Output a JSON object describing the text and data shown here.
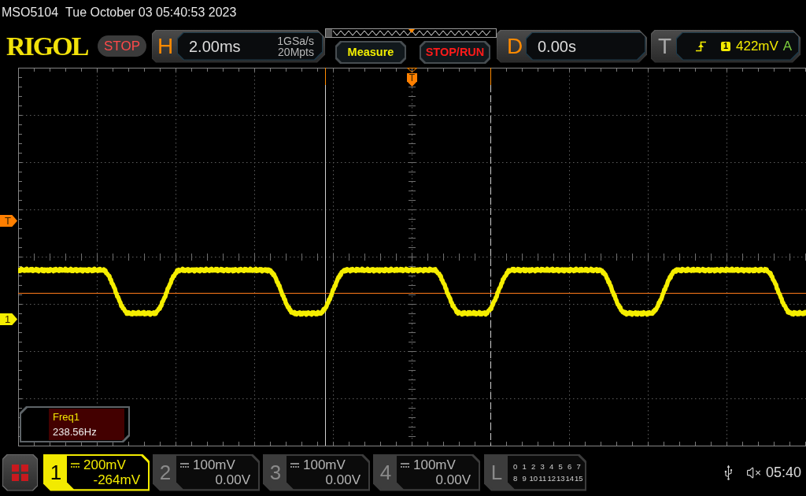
{
  "top_bar": {
    "model": "MSO5104",
    "datetime": "Tue October 03 05:40:53 2023"
  },
  "header": {
    "logo": "RIGOL",
    "run_state": "STOP",
    "horizontal": {
      "label": "H",
      "timebase": "2.00ms",
      "sample_rate": "1GSa/s",
      "memory_depth": "20Mpts"
    },
    "buttons": [
      {
        "label": "Measure",
        "kind": "measure"
      },
      {
        "label": "STOP/RUN",
        "kind": "run_stop"
      }
    ],
    "delay": {
      "label": "D",
      "value": "0.00s"
    },
    "trigger": {
      "label": "T",
      "source": "1",
      "level": "422mV",
      "mode": "A"
    }
  },
  "screen": {
    "trigger_position_marker": "T",
    "left_markers": [
      {
        "label": "T",
        "kind": "trigger"
      },
      {
        "label": "1",
        "kind": "channel"
      }
    ],
    "measurement": {
      "name": "Freq1",
      "value": "238.56Hz"
    }
  },
  "channels": [
    {
      "number": "1",
      "scale": "200mV",
      "offset": "-264mV",
      "on": true
    },
    {
      "number": "2",
      "scale": "100mV",
      "offset": "0.00V",
      "on": false
    },
    {
      "number": "3",
      "scale": "100mV",
      "offset": "0.00V",
      "on": false
    },
    {
      "number": "4",
      "scale": "100mV",
      "offset": "0.00V",
      "on": false
    }
  ],
  "logic": {
    "label": "L",
    "rows": [
      [
        "0",
        "1",
        "2",
        "3",
        "4",
        "5",
        "6",
        "7"
      ],
      [
        "8",
        "9",
        "10",
        "11",
        "12",
        "13",
        "14",
        "15"
      ]
    ]
  },
  "system": {
    "time": "05:40"
  }
}
